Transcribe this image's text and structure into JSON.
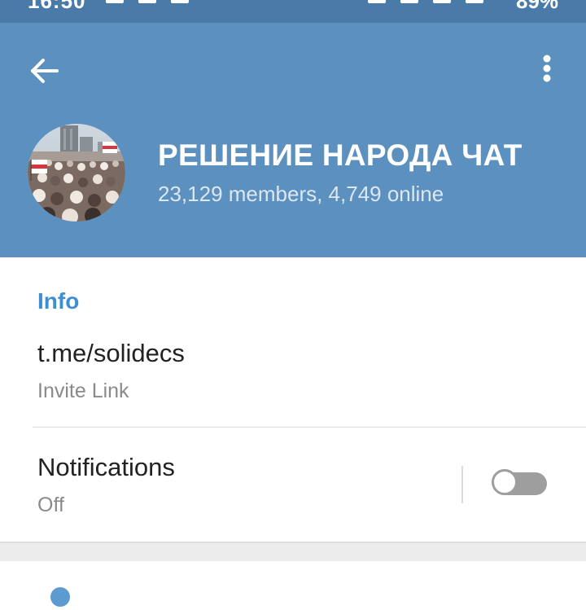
{
  "status_bar": {
    "time": "16:50",
    "battery": "89%"
  },
  "header": {
    "title": "РЕШЕНИЕ НАРОДА ЧАТ",
    "subtitle": "23,129 members, 4,749 online",
    "back_icon": "arrow-left-icon",
    "menu_icon": "more-vertical-icon"
  },
  "info": {
    "section_title": "Info",
    "link": {
      "value": "t.me/solidecs",
      "caption": "Invite Link"
    },
    "notifications": {
      "label": "Notifications",
      "status": "Off",
      "enabled": false
    }
  },
  "colors": {
    "header": "#5b90bf",
    "status_bar": "#4a7ba8",
    "accent": "#3d8fd1"
  }
}
